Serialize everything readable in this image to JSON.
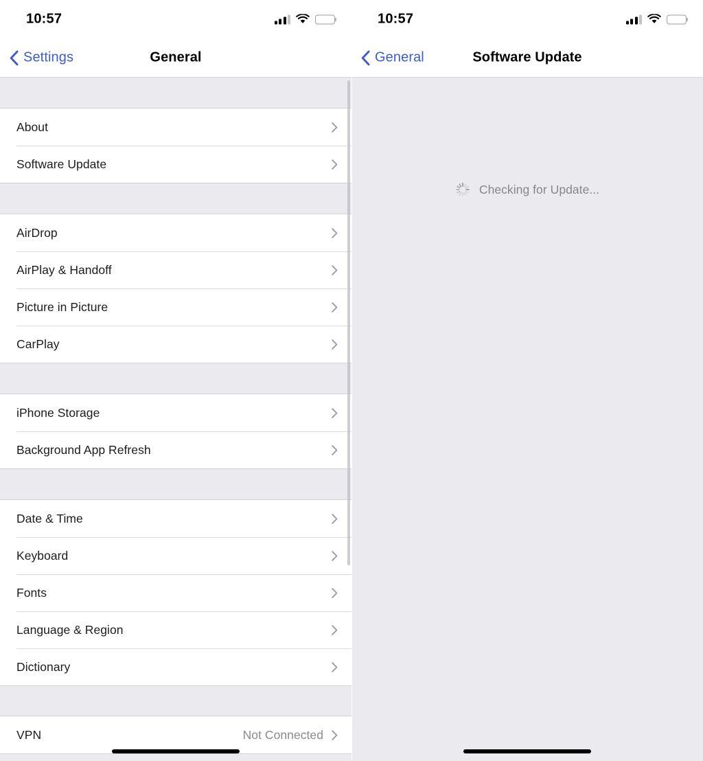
{
  "left_phone": {
    "status_bar": {
      "time": "10:57",
      "cellular_icon": "cellular-signal-icon",
      "wifi_icon": "wifi-icon",
      "battery_icon": "battery-icon"
    },
    "nav": {
      "back_label": "Settings",
      "back_icon": "chevron-left-icon",
      "title": "General"
    },
    "sections": [
      {
        "rows": [
          {
            "label": "About",
            "value": "",
            "accessory": "chevron-right-icon"
          },
          {
            "label": "Software Update",
            "value": "",
            "accessory": "chevron-right-icon"
          }
        ]
      },
      {
        "rows": [
          {
            "label": "AirDrop",
            "value": "",
            "accessory": "chevron-right-icon"
          },
          {
            "label": "AirPlay & Handoff",
            "value": "",
            "accessory": "chevron-right-icon"
          },
          {
            "label": "Picture in Picture",
            "value": "",
            "accessory": "chevron-right-icon"
          },
          {
            "label": "CarPlay",
            "value": "",
            "accessory": "chevron-right-icon"
          }
        ]
      },
      {
        "rows": [
          {
            "label": "iPhone Storage",
            "value": "",
            "accessory": "chevron-right-icon"
          },
          {
            "label": "Background App Refresh",
            "value": "",
            "accessory": "chevron-right-icon"
          }
        ]
      },
      {
        "rows": [
          {
            "label": "Date & Time",
            "value": "",
            "accessory": "chevron-right-icon"
          },
          {
            "label": "Keyboard",
            "value": "",
            "accessory": "chevron-right-icon"
          },
          {
            "label": "Fonts",
            "value": "",
            "accessory": "chevron-right-icon"
          },
          {
            "label": "Language & Region",
            "value": "",
            "accessory": "chevron-right-icon"
          },
          {
            "label": "Dictionary",
            "value": "",
            "accessory": "chevron-right-icon"
          }
        ]
      },
      {
        "rows": [
          {
            "label": "VPN",
            "value": "Not Connected",
            "accessory": "chevron-right-icon"
          }
        ]
      }
    ]
  },
  "right_phone": {
    "status_bar": {
      "time": "10:57",
      "cellular_icon": "cellular-signal-icon",
      "wifi_icon": "wifi-icon",
      "battery_icon": "battery-icon"
    },
    "nav": {
      "back_label": "General",
      "back_icon": "chevron-left-icon",
      "title": "Software Update"
    },
    "status_message": "Checking for Update...",
    "spinner_icon": "activity-spinner-icon"
  },
  "colors": {
    "accent_blue": "#3c5ccf",
    "group_background": "#ffffff",
    "page_background": "#eaeaef",
    "primary_text": "#1c1c1e",
    "secondary_text": "#8a8a8f",
    "separator": "#dcdce0"
  }
}
